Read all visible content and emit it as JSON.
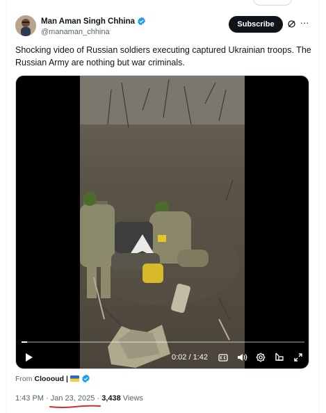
{
  "post": {
    "author_name": "Man Aman Singh Chhina",
    "author_handle": "@manaman_chhina",
    "subscribe_label": "Subscribe",
    "more_label": "···",
    "text_before": "Shocking video of ",
    "text_highlight": "Russian soldiers executing",
    "text_after": " captured Ukrainian troops. The Russian Army are nothing but war criminals.",
    "verified_color": "#1d9bf0"
  },
  "video": {
    "time_label": "0:02 / 1:42",
    "progress": 0.02
  },
  "source": {
    "from_label": "From",
    "name": "Clooоud |"
  },
  "meta": {
    "time": "1:43 PM",
    "sep1": "·",
    "date": "Jan 23, 2025",
    "sep2": "·",
    "views_count": "3,438",
    "views_label": "Views"
  },
  "annotation_color": "#d42b2b"
}
